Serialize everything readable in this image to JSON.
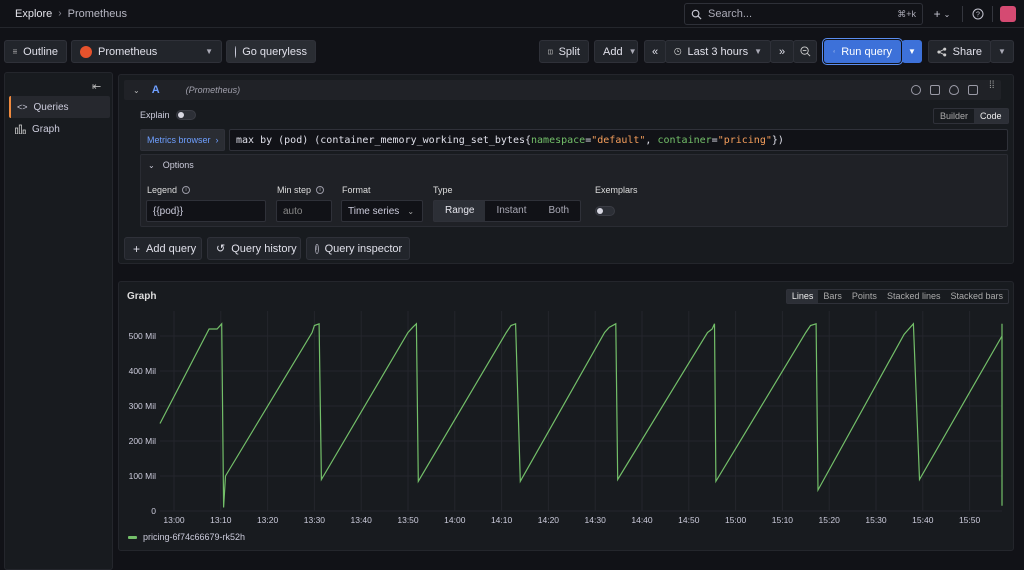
{
  "breadcrumb": {
    "root": "Explore",
    "current": "Prometheus"
  },
  "search": {
    "placeholder": "Search...",
    "shortcut": "⌘+k"
  },
  "toolbar": {
    "outline": "Outline",
    "datasource": "Prometheus",
    "go_queryless": "Go queryless",
    "split": "Split",
    "add": "Add",
    "time_range": "Last 3 hours",
    "run_query": "Run query",
    "share": "Share"
  },
  "sidebar": {
    "items": [
      {
        "label": "Queries"
      },
      {
        "label": "Graph"
      }
    ]
  },
  "query": {
    "ref_id": "A",
    "datasource_note": "(Prometheus)",
    "explain_label": "Explain",
    "mode_builder": "Builder",
    "mode_code": "Code",
    "metrics_browser": "Metrics browser",
    "expr": {
      "p1": "max by (pod) (container_memory_working_set_bytes{",
      "k1": "namespace",
      "eq1": "=",
      "v1": "\"default\"",
      "comma": ", ",
      "k2": "container",
      "eq2": "=",
      "v2": "\"pricing\"",
      "p2": "})"
    },
    "options": {
      "title": "Options",
      "legend_label": "Legend",
      "legend_value": "{{pod}}",
      "min_step_label": "Min step",
      "min_step_placeholder": "auto",
      "format_label": "Format",
      "format_value": "Time series",
      "type_label": "Type",
      "type_options": [
        "Range",
        "Instant",
        "Both"
      ],
      "type_selected": "Range",
      "exemplars_label": "Exemplars"
    },
    "actions": {
      "add_query": "Add query",
      "query_history": "Query history",
      "query_inspector": "Query inspector"
    }
  },
  "graph": {
    "title": "Graph",
    "view_modes": [
      "Lines",
      "Bars",
      "Points",
      "Stacked lines",
      "Stacked bars"
    ],
    "view_selected": "Lines",
    "legend": "pricing-6f74c66679-rk52h"
  },
  "colors": {
    "series": "#73bf69",
    "accent": "#3d71d9",
    "active_tab": "#f08a3e"
  },
  "chart_data": {
    "type": "line",
    "x_ticks": [
      "13:00",
      "13:10",
      "13:20",
      "13:30",
      "13:40",
      "13:50",
      "14:00",
      "14:10",
      "14:20",
      "14:30",
      "14:40",
      "14:50",
      "15:00",
      "15:10",
      "15:20",
      "15:30",
      "15:40",
      "15:50"
    ],
    "y_ticks": [
      "0",
      "100 Mil",
      "200 Mil",
      "300 Mil",
      "400 Mil",
      "500 Mil"
    ],
    "ylim": [
      0,
      560
    ],
    "xlim_minutes": [
      0,
      180
    ],
    "grid": true,
    "series": [
      {
        "name": "pricing-6f74c66679-rk52h",
        "x_minutes": [
          -3,
          7.5,
          9.2,
          10.2,
          10.6,
          11,
          29.5,
          30,
          31,
          31.5,
          50,
          51,
          51.8,
          52.2,
          71,
          72,
          73,
          74,
          92,
          93,
          94.4,
          94.8,
          114,
          115,
          115.5,
          115.8,
          135,
          136,
          137.2,
          137.6,
          156,
          157,
          158,
          159.3,
          177,
          178,
          178.6,
          179
        ],
        "y_mil": [
          250,
          520,
          520,
          535,
          10,
          100,
          510,
          530,
          535,
          90,
          510,
          525,
          535,
          85,
          510,
          530,
          535,
          85,
          510,
          525,
          535,
          90,
          510,
          520,
          535,
          85,
          510,
          530,
          535,
          60,
          505,
          520,
          535,
          90,
          500,
          510,
          535,
          15
        ]
      }
    ]
  }
}
